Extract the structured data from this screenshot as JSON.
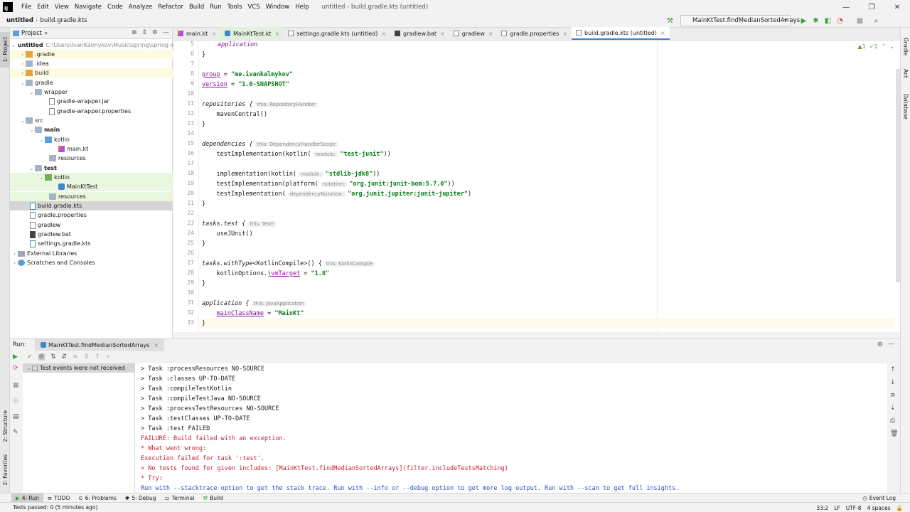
{
  "menubar": {
    "logo": "IJ",
    "items": [
      "File",
      "Edit",
      "View",
      "Navigate",
      "Code",
      "Analyze",
      "Refactor",
      "Build",
      "Run",
      "Tools",
      "VCS",
      "Window",
      "Help"
    ],
    "window_title": "untitled - build.gradle.kts (untitled)",
    "controls": [
      "—",
      "❐",
      "✕"
    ]
  },
  "navbar": {
    "breadcrumbs": [
      "untitled",
      "build.gradle.kts"
    ],
    "run_config": "MainKtTest.findMedianSortedArrays"
  },
  "left_strip": {
    "project": "1: Project",
    "structure": "2: Structure",
    "favorites": "2: Favorites"
  },
  "right_strip": {
    "gradle": "Gradle",
    "ant": "Ant",
    "database": "Database"
  },
  "project": {
    "header": "Project",
    "tree": [
      {
        "label": "untitled",
        "hint": "C:\\Users\\IvanKalmykov\\Music\\spring\\spring m"
      },
      {
        "label": ".gradle"
      },
      {
        "label": ".idea"
      },
      {
        "label": "build"
      },
      {
        "label": "gradle"
      },
      {
        "label": "wrapper"
      },
      {
        "label": "gradle-wrapper.jar"
      },
      {
        "label": "gradle-wrapper.properties"
      },
      {
        "label": "src"
      },
      {
        "label": "main"
      },
      {
        "label": "kotlin"
      },
      {
        "label": "main.kt"
      },
      {
        "label": "resources"
      },
      {
        "label": "test"
      },
      {
        "label": "kotlin"
      },
      {
        "label": "MainKtTest"
      },
      {
        "label": "resources"
      },
      {
        "label": "build.gradle.kts"
      },
      {
        "label": "gradle.properties"
      },
      {
        "label": "gradlew"
      },
      {
        "label": "gradlew.bat"
      },
      {
        "label": "settings.gradle.kts"
      },
      {
        "label": "External Libraries"
      },
      {
        "label": "Scratches and Consoles"
      }
    ]
  },
  "editor_tabs": [
    "main.kt",
    "MainKtTest.kt",
    "settings.gradle.kts (untitled)",
    "gradlew.bat",
    "gradlew",
    "gradle.properties",
    "build.gradle.kts (untitled)"
  ],
  "editor": {
    "status": [
      "▲1",
      "✓1"
    ],
    "line_numbers": [
      "5",
      "6",
      "7",
      "8",
      "9",
      "10",
      "11",
      "12",
      "13",
      "14",
      "15",
      "16",
      "17",
      "18",
      "19",
      "20",
      "21",
      "22",
      "23",
      "24",
      "25",
      "26",
      "27",
      "28",
      "29",
      "30",
      "31",
      "32",
      "33"
    ],
    "code": {
      "l5": "application",
      "l6": "}",
      "l8a": "group",
      "l8b": " = ",
      "l8c": "\"me.ivankalmykov\"",
      "l9a": "version",
      "l9b": " = ",
      "l9c": "\"1.0-SNAPSHOT\"",
      "l11a": "repositories {",
      "l11h": "this: RepositoryHandler",
      "l12": "    mavenCentral()",
      "l13": "}",
      "l15a": "dependencies {",
      "l15h": "this: DependencyHandlerScope",
      "l16a": "    testImplementation(kotlin(",
      "l16h": "module:",
      "l16s": "\"test-junit\"",
      "l16e": "))",
      "l18a": "    implementation(kotlin(",
      "l18h": "module:",
      "l18s": "\"stdlib-jdk8\"",
      "l18e": "))",
      "l19a": "    testImplementation(platform(",
      "l19h": "notation:",
      "l19s": "\"org.junit:junit-bom:5.7.0\"",
      "l19e": "))",
      "l20a": "    testImplementation(",
      "l20h": "dependencyNotation:",
      "l20s": "\"org.junit.jupiter:junit-jupiter\"",
      "l20e": ")",
      "l21": "}",
      "l23a": "tasks.test {",
      "l23h": "this: Test!",
      "l24": "    useJUnit()",
      "l25": "}",
      "l27a": "tasks.withType",
      "l27b": "<KotlinCompile>() {",
      "l27h": "this: KotlinCompile",
      "l28a": "    kotlinOptions.",
      "l28b": "jvmTarget",
      "l28c": " = ",
      "l28s": "\"1.8\"",
      "l29": "}",
      "l31a": "application {",
      "l31h": "this: JavaApplication",
      "l32a": "    ",
      "l32b": "mainClassName",
      "l32c": " = ",
      "l32s": "\"MainKt\"",
      "l33": "}"
    }
  },
  "run": {
    "label": "Run:",
    "tab": "MainKtTest.findMedianSortedArrays",
    "test_tree_item": "Test events were not received",
    "console": [
      "> Task :processResources NO-SOURCE",
      "> Task :classes UP-TO-DATE",
      "> Task :compileTestKotlin",
      "> Task :compileTestJava NO-SOURCE",
      "> Task :processTestResources NO-SOURCE",
      "> Task :testClasses UP-TO-DATE",
      "> Task :test FAILED",
      "FAILURE: Build failed with an exception.",
      "* What went wrong:",
      "Execution failed for task ':test'.",
      "> No tests found for given includes: [MainKtTest.findMedianSortedArrays](filter.includeTestsMatching)",
      "* Try:",
      "Run with --stacktrace option to get the stack trace. Run with --info or --debug option to get more log output. Run with --scan to get full insights."
    ]
  },
  "bottom_tabs": [
    "4: Run",
    "TODO",
    "6: Problems",
    "5: Debug",
    "Terminal",
    "Build"
  ],
  "event_log": "Event Log",
  "status": {
    "message": "Tests passed: 0 (5 minutes ago)",
    "position": "33:2",
    "line_sep": "LF",
    "encoding": "UTF-8",
    "indent": "4 spaces"
  }
}
